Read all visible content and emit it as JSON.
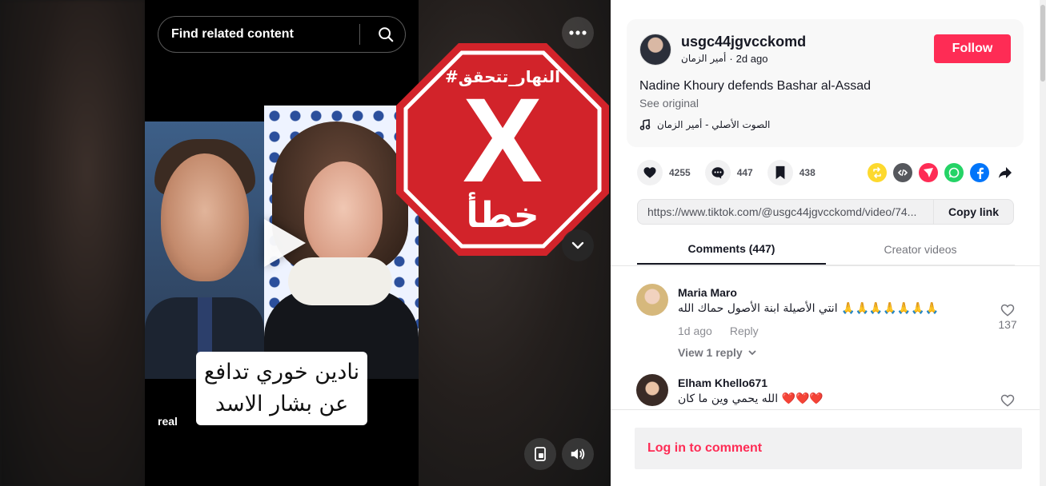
{
  "search": {
    "placeholder": "Find related content"
  },
  "video": {
    "caption_lines": [
      "نادين خوري تدافع",
      "عن بشار الاسد"
    ],
    "real_tag": "real",
    "overlay": {
      "hashtag": "#النهار_تتحقق",
      "mark": "X",
      "verdict": "خطأ",
      "color": "#d2232a"
    }
  },
  "creator": {
    "username": "usgc44jgvcckomd",
    "nickname": "أمير الزمان",
    "separator": "·",
    "posted": "2d ago",
    "follow_label": "Follow"
  },
  "post": {
    "description": "Nadine Khoury defends Bashar al-Assad",
    "see_original": "See original",
    "music": "الصوت الأصلي - أمير الزمان"
  },
  "stats": {
    "likes": "4255",
    "comments": "447",
    "saves": "438"
  },
  "share_icons": [
    {
      "name": "repost-icon",
      "color": "#fdd92e"
    },
    {
      "name": "embed-icon",
      "color": "#56585d"
    },
    {
      "name": "send-icon",
      "color": "#fe2c55"
    },
    {
      "name": "whatsapp-icon",
      "color": "#25d366"
    },
    {
      "name": "facebook-icon",
      "color": "#0075fa"
    },
    {
      "name": "share-arrow-icon",
      "color": "#161823"
    }
  ],
  "link": {
    "url": "https://www.tiktok.com/@usgc44jgvcckomd/video/74...",
    "copy_label": "Copy link"
  },
  "tabs": {
    "comments": "Comments (447)",
    "creator_videos": "Creator videos"
  },
  "comments": [
    {
      "name": "Maria Maro",
      "text": "انتي الأصيلة ابنة الأصول حماك الله 🙏🙏🙏🙏🙏🙏🙏",
      "time": "1d ago",
      "reply_label": "Reply",
      "likes": "137",
      "replies_label": "View 1 reply"
    },
    {
      "name": "Elham Khello671",
      "text": "الله يحمي وين ما كان ❤️❤️❤️",
      "time": "",
      "reply_label": "",
      "likes": "",
      "replies_label": ""
    }
  ],
  "login": {
    "label": "Log in to comment"
  },
  "colors": {
    "accent": "#fe2c55"
  }
}
